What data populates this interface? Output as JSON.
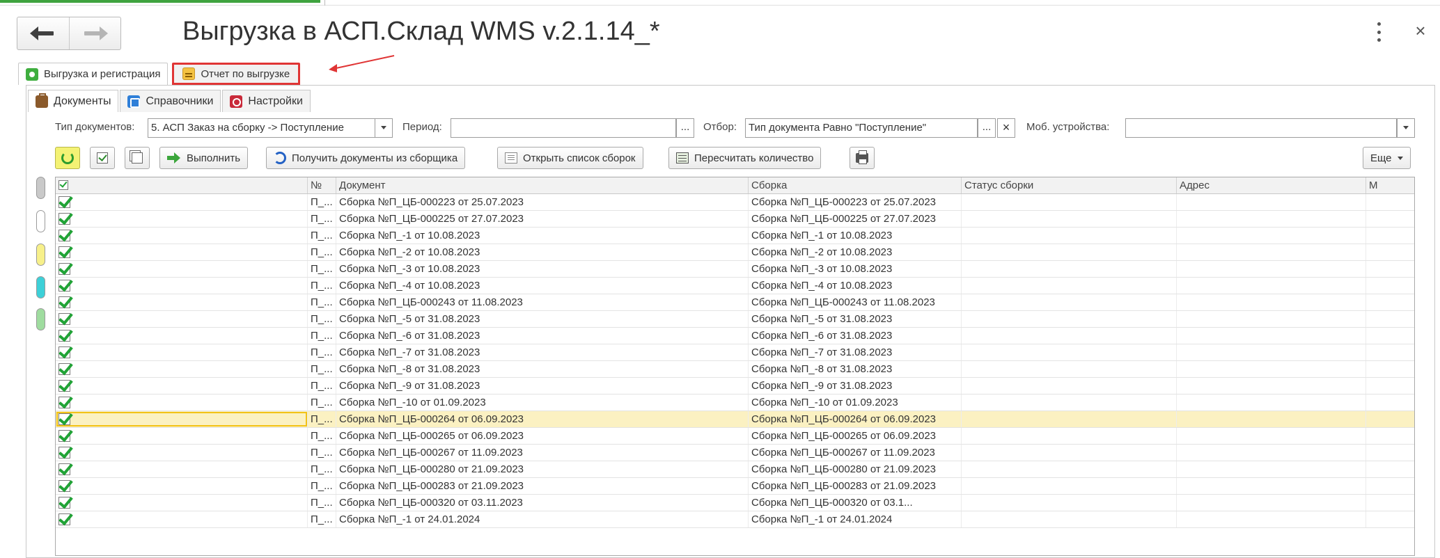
{
  "window": {
    "title": "Выгрузка в АСП.Склад WMS v.2.1.14_*"
  },
  "form_tabs": [
    {
      "label": "Выгрузка и регистрация",
      "icon": "green-document-icon"
    },
    {
      "label": "Отчет по выгрузке",
      "icon": "report-icon"
    }
  ],
  "inner_tabs": [
    {
      "label": "Документы",
      "icon": "briefcase-icon"
    },
    {
      "label": "Справочники",
      "icon": "catalog-icon"
    },
    {
      "label": "Настройки",
      "icon": "settings-icon"
    }
  ],
  "filters": {
    "doc_type_label": "Тип документов:",
    "doc_type_value": "5. АСП Заказ на сборку -> Поступление",
    "period_label": "Период:",
    "period_value": "",
    "filter_label": "Отбор:",
    "filter_value": "Тип документа Равно \"Поступление\"",
    "devices_label": "Моб. устройства:",
    "devices_value": "",
    "ellipsis": "...",
    "clear": "×"
  },
  "toolbar": {
    "execute": "Выполнить",
    "get_docs": "Получить документы из сборщика",
    "open_list": "Открыть список сборок",
    "recalc": "Пересчитать количество",
    "more": "Еще"
  },
  "table": {
    "columns": [
      "",
      "№",
      "Документ",
      "Сборка",
      "Статус сборки",
      "Адрес",
      "М"
    ],
    "rows": [
      {
        "num": "П_...",
        "doc": "Сборка №П_ЦБ-000223 от 25.07.2023",
        "assembly": "Сборка №П_ЦБ-000223 от 25.07.2023"
      },
      {
        "num": "П_...",
        "doc": "Сборка №П_ЦБ-000225 от 27.07.2023",
        "assembly": "Сборка №П_ЦБ-000225 от 27.07.2023"
      },
      {
        "num": "П_...",
        "doc": "Сборка №П_-1 от 10.08.2023",
        "assembly": "Сборка №П_-1 от 10.08.2023"
      },
      {
        "num": "П_...",
        "doc": "Сборка №П_-2 от 10.08.2023",
        "assembly": "Сборка №П_-2 от 10.08.2023"
      },
      {
        "num": "П_...",
        "doc": "Сборка №П_-3 от 10.08.2023",
        "assembly": "Сборка №П_-3 от 10.08.2023"
      },
      {
        "num": "П_...",
        "doc": "Сборка №П_-4 от 10.08.2023",
        "assembly": "Сборка №П_-4 от 10.08.2023"
      },
      {
        "num": "П_...",
        "doc": "Сборка №П_ЦБ-000243 от 11.08.2023",
        "assembly": "Сборка №П_ЦБ-000243 от 11.08.2023"
      },
      {
        "num": "П_...",
        "doc": "Сборка №П_-5 от 31.08.2023",
        "assembly": "Сборка №П_-5 от 31.08.2023"
      },
      {
        "num": "П_...",
        "doc": "Сборка №П_-6 от 31.08.2023",
        "assembly": "Сборка №П_-6 от 31.08.2023"
      },
      {
        "num": "П_...",
        "doc": "Сборка №П_-7 от 31.08.2023",
        "assembly": "Сборка №П_-7 от 31.08.2023"
      },
      {
        "num": "П_...",
        "doc": "Сборка №П_-8 от 31.08.2023",
        "assembly": "Сборка №П_-8 от 31.08.2023"
      },
      {
        "num": "П_...",
        "doc": "Сборка №П_-9 от 31.08.2023",
        "assembly": "Сборка №П_-9 от 31.08.2023"
      },
      {
        "num": "П_...",
        "doc": "Сборка №П_-10 от 01.09.2023",
        "assembly": "Сборка №П_-10 от 01.09.2023"
      },
      {
        "num": "П_...",
        "doc": "Сборка №П_ЦБ-000264 от 06.09.2023",
        "assembly": "Сборка №П_ЦБ-000264 от 06.09.2023"
      },
      {
        "num": "П_...",
        "doc": "Сборка №П_ЦБ-000265 от 06.09.2023",
        "assembly": "Сборка №П_ЦБ-000265 от 06.09.2023"
      },
      {
        "num": "П_...",
        "doc": "Сборка №П_ЦБ-000267 от 11.09.2023",
        "assembly": "Сборка №П_ЦБ-000267 от 11.09.2023"
      },
      {
        "num": "П_...",
        "doc": "Сборка №П_ЦБ-000280 от 21.09.2023",
        "assembly": "Сборка №П_ЦБ-000280 от 21.09.2023"
      },
      {
        "num": "П_...",
        "doc": "Сборка №П_ЦБ-000283 от 21.09.2023",
        "assembly": "Сборка №П_ЦБ-000283 от 21.09.2023"
      },
      {
        "num": "П_...",
        "doc": "Сборка №П_ЦБ-000320        от 03.11.2023",
        "assembly": "Сборка №П_ЦБ-000320        от 03.1..."
      },
      {
        "num": "П_...",
        "doc": "Сборка №П_-1 от 24.01.2024",
        "assembly": "Сборка №П_-1 от 24.01.2024"
      }
    ],
    "selected_row": 13
  },
  "colors": {
    "accent_red": "#e03535",
    "check_green": "#21a336",
    "selected_row": "#fbf1c2",
    "refresh_yellow": "#f4f274"
  },
  "sidebar_pills": [
    "#c9c9c9",
    "#ffffff",
    "#f7f08a",
    "#3dd0d8",
    "#9fdc9f"
  ]
}
